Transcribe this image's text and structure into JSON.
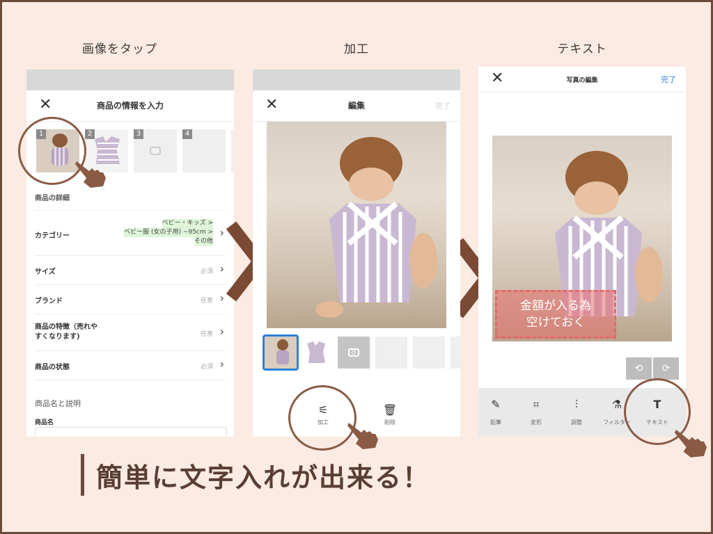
{
  "steps": {
    "step1_title": "画像をタップ",
    "step2_title": "加工",
    "step3_title": "テキスト"
  },
  "screen1": {
    "header_title": "商品の情報を入力",
    "close_icon": "close-icon",
    "thumbnails": [
      "1",
      "2",
      "3",
      "4"
    ],
    "section_details": "商品の詳細",
    "category_label": "カテゴリー",
    "category_value_line1": "ベビー・キッズ >",
    "category_value_line2": "ベビー服 (女の子用) ~95cm >",
    "category_value_line3": "その他",
    "size_label": "サイズ",
    "size_value": "必須",
    "brand_label": "ブランド",
    "brand_value": "任意",
    "features_label_line1": "商品の特徴（売れや",
    "features_label_line2": "すくなります)",
    "features_value": "任意",
    "condition_label": "商品の状態",
    "condition_value": "必須",
    "section_name": "商品名と説明",
    "name_label": "商品名"
  },
  "screen2": {
    "header_title": "編集",
    "done_label": "完了",
    "tool_edit_label": "加工",
    "tool_delete_label": "削除"
  },
  "screen3": {
    "header_title": "写真の編集",
    "done_label": "完了",
    "overlay_line1": "金額が入る為",
    "overlay_line2": "空けておく",
    "tools": [
      {
        "label": "鉛筆",
        "icon": "pencil-icon"
      },
      {
        "label": "変形",
        "icon": "crop-icon"
      },
      {
        "label": "調整",
        "icon": "sliders-icon"
      },
      {
        "label": "フィルター",
        "icon": "filter-icon"
      },
      {
        "label": "テキスト",
        "icon": "text-icon"
      }
    ]
  },
  "caption": "簡単に文字入れが出来る！",
  "colors": {
    "background": "#fbebe2",
    "accent_brown": "#6b4a3a",
    "link_blue": "#2f7fd6",
    "highlight_green": "#dff5d8",
    "overlay_red": "#e06b6b"
  }
}
